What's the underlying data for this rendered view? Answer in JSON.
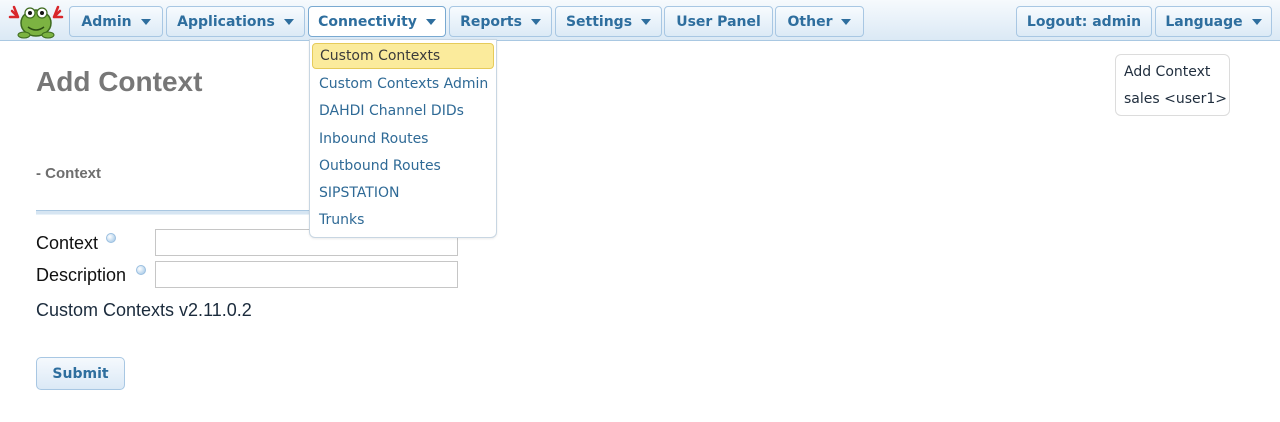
{
  "nav": {
    "items": [
      {
        "label": "Admin"
      },
      {
        "label": "Applications"
      },
      {
        "label": "Connectivity"
      },
      {
        "label": "Reports"
      },
      {
        "label": "Settings"
      },
      {
        "label": "User Panel"
      },
      {
        "label": "Other"
      }
    ],
    "logout_label": "Logout: admin",
    "language_label": "Language"
  },
  "dropdown": {
    "items": [
      {
        "label": "Custom Contexts"
      },
      {
        "label": "Custom Contexts Admin"
      },
      {
        "label": "DAHDI Channel DIDs"
      },
      {
        "label": "Inbound Routes"
      },
      {
        "label": "Outbound Routes"
      },
      {
        "label": "SIPSTATION"
      },
      {
        "label": "Trunks"
      }
    ]
  },
  "main": {
    "title": "Add Context",
    "section_title": "- Context",
    "fields": [
      {
        "label": "Context",
        "value": ""
      },
      {
        "label": "Description",
        "value": ""
      }
    ],
    "version": "Custom Contexts v2.11.0.2",
    "submit_label": "Submit"
  },
  "rightbox": {
    "items": [
      {
        "label": "Add Context"
      },
      {
        "label": "sales <user1>"
      }
    ]
  },
  "colors": {
    "accent": "#2e6e9e",
    "nav_border": "#a8c7e3",
    "hover": "#fbeb9c"
  }
}
